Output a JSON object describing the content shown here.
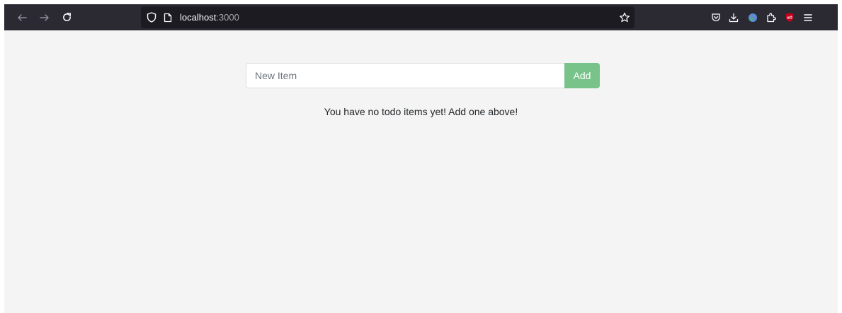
{
  "browser": {
    "url_host": "localhost",
    "url_port": ":3000",
    "icons": {
      "back": "arrow-left-icon",
      "forward": "arrow-right-icon",
      "reload": "reload-icon",
      "shield": "shield-icon",
      "page": "page-icon",
      "bookmark": "star-icon",
      "pocket": "pocket-icon",
      "downloads": "download-icon",
      "extension_colorful": "extension-icon",
      "extensions": "puzzle-icon",
      "ublock": "ublock-icon",
      "menu": "hamburger-menu-icon"
    },
    "colors": {
      "toolbar": "#2b2a33",
      "urlbar": "#1c1b22",
      "ublock_red": "#c1001a"
    }
  },
  "todo": {
    "input_placeholder": "New Item",
    "add_label": "Add",
    "empty_message": "You have no todo items yet! Add one above!",
    "colors": {
      "add_button": "#78c38a",
      "background": "#f4f4f4"
    }
  }
}
